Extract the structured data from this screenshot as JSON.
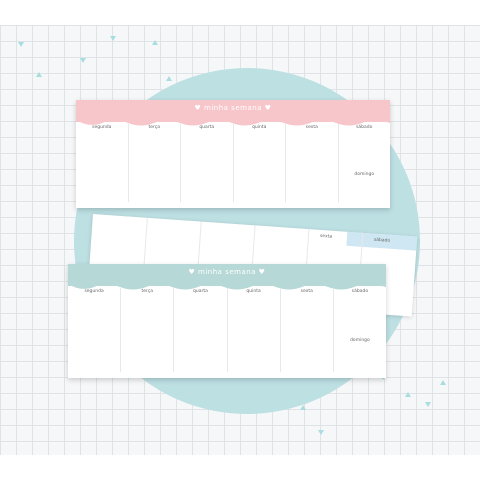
{
  "colors": {
    "pink_header": "#f7c6cb",
    "mint_header": "#b6d8d6",
    "circle": "#bde0e3",
    "grid": "#dfe3e6",
    "confetti": "#a9dde0"
  },
  "top_planner": {
    "title": "♥ minha semana ♥",
    "days": [
      "segunda",
      "terça",
      "quarta",
      "quinta",
      "sexta",
      "sábado"
    ],
    "sunday": "domingo"
  },
  "back_planner": {
    "labels": [
      "sexta",
      "sábado"
    ]
  },
  "bottom_planner": {
    "title": "♥ minha semana ♥",
    "days": [
      "segunda",
      "terça",
      "quarta",
      "quinta",
      "sexta",
      "sábado"
    ],
    "sunday": "domingo"
  }
}
